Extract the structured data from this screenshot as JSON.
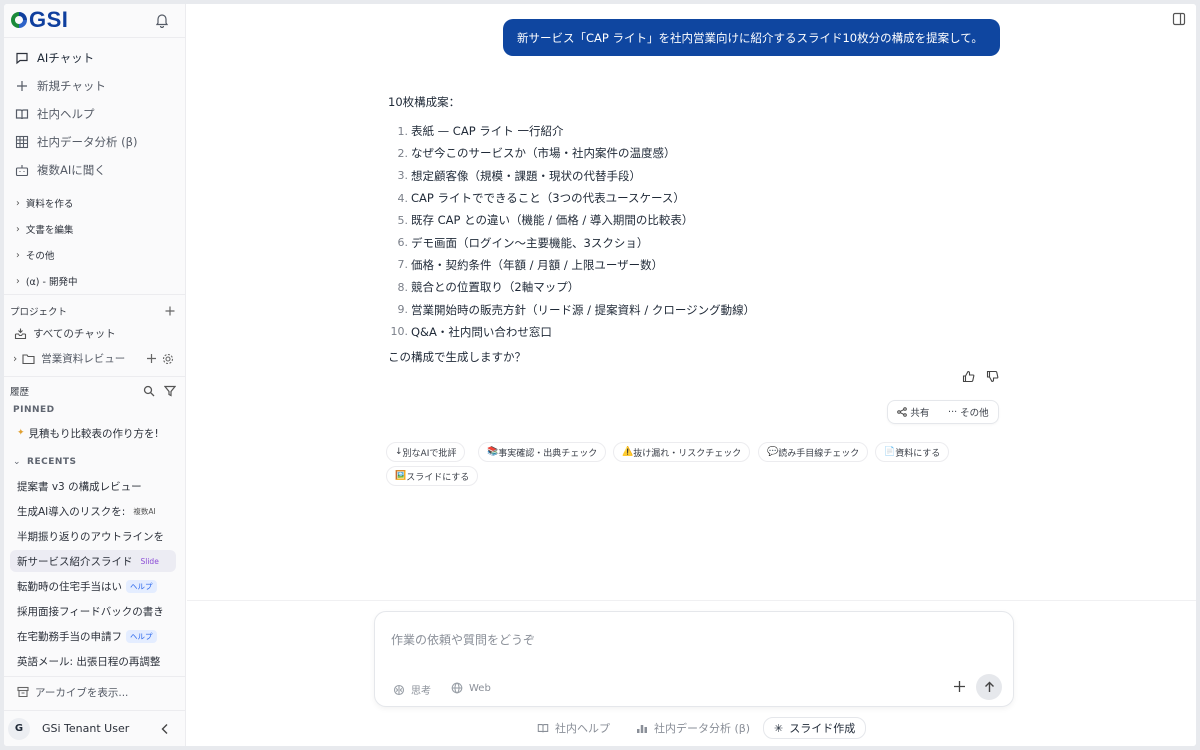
{
  "app": {
    "logo_text": "GSI"
  },
  "sidebar": {
    "nav": [
      {
        "label": "AIチャット",
        "icon": "chat-bubble-icon"
      },
      {
        "label": "新規チャット",
        "icon": "plus-icon"
      },
      {
        "label": "社内ヘルプ",
        "icon": "book-icon"
      },
      {
        "label": "社内データ分析 (β)",
        "icon": "table-grid-icon"
      },
      {
        "label": "複数AIに聞く",
        "icon": "robot-icon"
      }
    ],
    "groups": [
      "資料を作る",
      "文書を編集",
      "その他",
      "(α) - 開発中"
    ],
    "projects": {
      "title": "プロジェクト",
      "all_chats": "すべてのチャット",
      "folder": "営業資料レビュー"
    },
    "history": {
      "title": "履歴",
      "pinned_label": "PINNED",
      "pinned_item": "見積もり比較表の作り方を!",
      "recents_label": "RECENTS",
      "items": [
        {
          "label": "提案書 v3 の構成レビュー",
          "tag": ""
        },
        {
          "label": "生成AI導入のリスクを:",
          "tag": "複数AI"
        },
        {
          "label": "半期振り返りのアウトラインを",
          "tag": ""
        },
        {
          "label": "新サービス紹介スライド",
          "tag": "Slide"
        },
        {
          "label": "転勤時の住宅手当はい",
          "tag": "ヘルプ"
        },
        {
          "label": "採用面接フィードバックの書き",
          "tag": ""
        },
        {
          "label": "在宅勤務手当の申請フ",
          "tag": "ヘルプ"
        },
        {
          "label": "英語メール: 出張日程の再調整",
          "tag": ""
        }
      ],
      "archive": "アーカイブを表示..."
    },
    "user": {
      "initial": "G",
      "name": "GSi Tenant User"
    }
  },
  "chat": {
    "user_message": "新サービス「CAP ライト」を社内営業向けに紹介するスライド10枚分の構成を提案して。",
    "answer_intro": "10枚構成案：",
    "answer_items": [
      {
        "n": "1.",
        "text": "表紙 — CAP ライト 一行紹介"
      },
      {
        "n": "2.",
        "text": "なぜ今このサービスか（市場・社内案件の温度感）"
      },
      {
        "n": "3.",
        "text": "想定顧客像（規模・課題・現状の代替手段）"
      },
      {
        "n": "4.",
        "text": "CAP ライトでできること（3つの代表ユースケース）"
      },
      {
        "n": "5.",
        "text": "既存 CAP との違い（機能 / 価格 / 導入期間の比較表）"
      },
      {
        "n": "6.",
        "text": "デモ画面（ログイン〜主要機能、3スクショ）"
      },
      {
        "n": "7.",
        "text": "価格・契約条件（年額 / 月額 / 上限ユーザー数）"
      },
      {
        "n": "8.",
        "text": "競合との位置取り（2軸マップ）"
      },
      {
        "n": "9.",
        "text": "営業開始時の販売方針（リード源 / 提案資料 / クロージング動線）"
      },
      {
        "n": "10.",
        "text": "Q&A・社内問い合わせ窓口"
      }
    ],
    "answer_outro": "この構成で生成しますか？",
    "share_label": "共有",
    "more_label": "その他",
    "chips": [
      {
        "icon": "↓",
        "label": "別なAIで批評"
      },
      {
        "icon": "📚",
        "label": "事実確認・出典チェック"
      },
      {
        "icon": "⚠️",
        "label": "抜け漏れ・リスクチェック"
      },
      {
        "icon": "💬",
        "label": "読み手目線チェック"
      },
      {
        "icon": "📄",
        "label": "資料にする"
      },
      {
        "icon": "🖼️",
        "label": "スライドにする"
      }
    ]
  },
  "composer": {
    "placeholder": "作業の依頼や質問をどうぞ",
    "think_label": "思考",
    "web_label": "Web"
  },
  "quick_actions": [
    {
      "label": "社内ヘルプ",
      "icon": "book-icon"
    },
    {
      "label": "社内データ分析 (β)",
      "icon": "chart-icon"
    },
    {
      "label": "スライド作成",
      "icon": "sparkle-icon"
    }
  ],
  "colors": {
    "accent": "#0f46a0",
    "bubble_text": "#ffffff",
    "slide_tag": "#8b4bd6",
    "help_tag": "#2563eb"
  }
}
